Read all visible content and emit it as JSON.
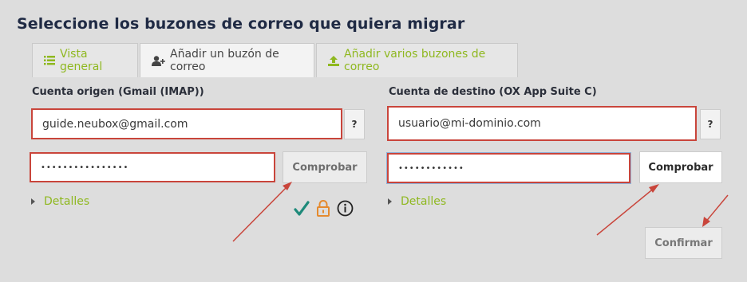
{
  "page": {
    "title": "Seleccione los buzones de correo que quiera migrar"
  },
  "tabs": [
    {
      "label": "Vista general",
      "icon": "list-icon",
      "state": "inactive"
    },
    {
      "label": "Añadir un buzón de correo",
      "icon": "add-user-icon",
      "state": "active"
    },
    {
      "label": "Añadir varios buzones de correo",
      "icon": "upload-icon",
      "state": "inactive"
    }
  ],
  "source": {
    "label": "Cuenta origen (Gmail (IMAP))",
    "email_value": "guide.neubox@gmail.com",
    "password_value": "••••••••••••••••",
    "help_label": "?",
    "check_label": "Comprobar",
    "details_label": "Detalles",
    "status_icons": [
      "checkmark-icon",
      "lock-icon",
      "info-icon"
    ]
  },
  "destination": {
    "label": "Cuenta de destino (OX App Suite C)",
    "email_value": "usuario@mi-dominio.com",
    "password_value": "••••••••••••",
    "help_label": "?",
    "check_label": "Comprobar",
    "details_label": "Detalles"
  },
  "actions": {
    "confirm_label": "Confirmar"
  },
  "colors": {
    "accent_green": "#8fb820",
    "highlight_red": "#c9453b",
    "check_teal": "#1e8a7a",
    "lock_orange": "#e58a2e"
  }
}
